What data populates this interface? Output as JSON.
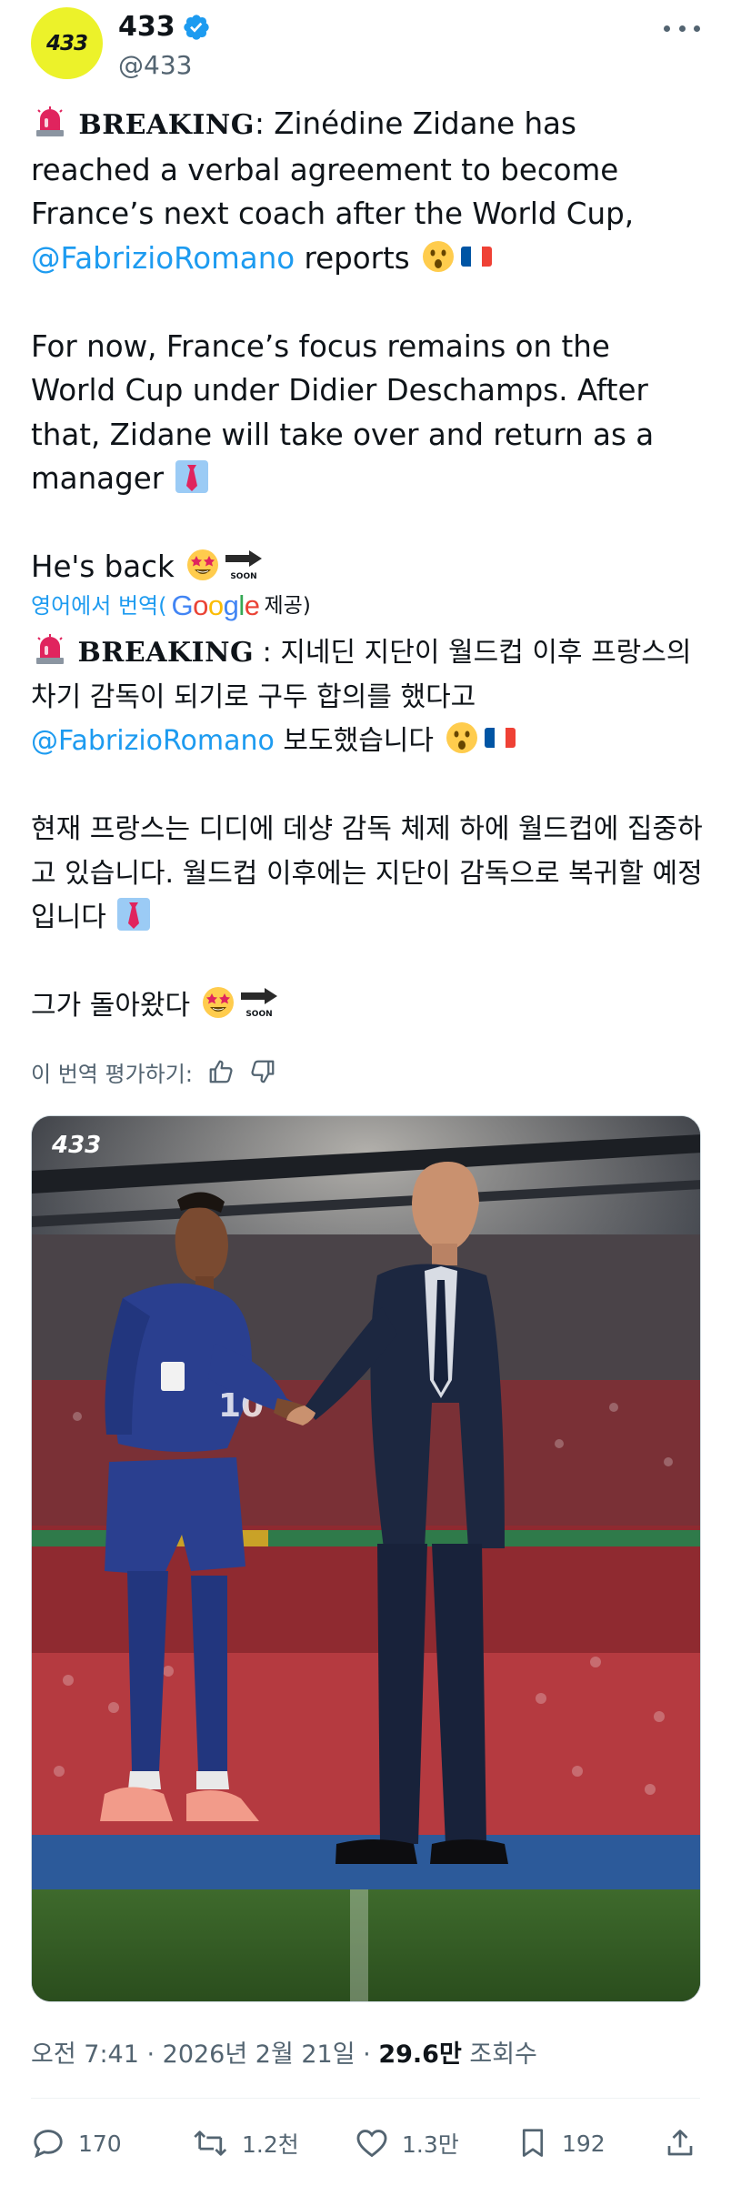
{
  "author": {
    "avatar_text": "433",
    "display_name": "433",
    "handle": "@433",
    "verified": true
  },
  "tweet": {
    "p1_word": "BREAKING",
    "p1_a": ": Zinédine Zidane has reached a verbal agreement to become France’s next coach after the World Cup, ",
    "p1_mention": "@FabrizioRomano",
    "p1_b": " reports",
    "p2": "For now, France’s focus remains on the World Cup under Didier Deschamps. After that, Zidane will take over and return as a manager",
    "p3": "He's back"
  },
  "translation": {
    "label": "영어에서 번역(",
    "google": "Google",
    "provided": "제공)",
    "p1_word": "BREAKING",
    "p1_a": " : 지네딘 지단이 월드컵 이후 프랑스의 차기 감독이 되기로 구두 합의를 했다고 ",
    "p1_mention": "@FabrizioRomano",
    "p1_b": " 보도했습니다",
    "p2": "현재 프랑스는 디디에 데샹 감독 체제 하에 월드컵에 집중하고 있습니다. 월드컵 이후에는 지단이 감독으로 복귀할 예정입니다",
    "p3": "그가 돌아왔다",
    "rate_label": "이 번역 평가하기:"
  },
  "media": {
    "watermark": "433",
    "jersey_number": "10"
  },
  "meta": {
    "time": "오전 7:41 · 2026년 2월 21일 · ",
    "views": "29.6만",
    "views_label": " 조회수"
  },
  "actions": {
    "replies": "170",
    "reposts": "1.2천",
    "likes": "1.3만",
    "bookmarks": "192"
  },
  "colors": {
    "link": "#1d9bf0",
    "secondary": "#536471",
    "avatar_bg": "#ecf22a"
  },
  "icons": [
    "verified-badge-icon",
    "more-icon",
    "siren-emoji",
    "surprised-emoji",
    "france-flag-emoji",
    "necktie-emoji",
    "star-struck-emoji",
    "soon-arrow-emoji",
    "thumbs-up-icon",
    "thumbs-down-icon",
    "reply-icon",
    "repost-icon",
    "like-icon",
    "bookmark-icon",
    "share-icon"
  ]
}
